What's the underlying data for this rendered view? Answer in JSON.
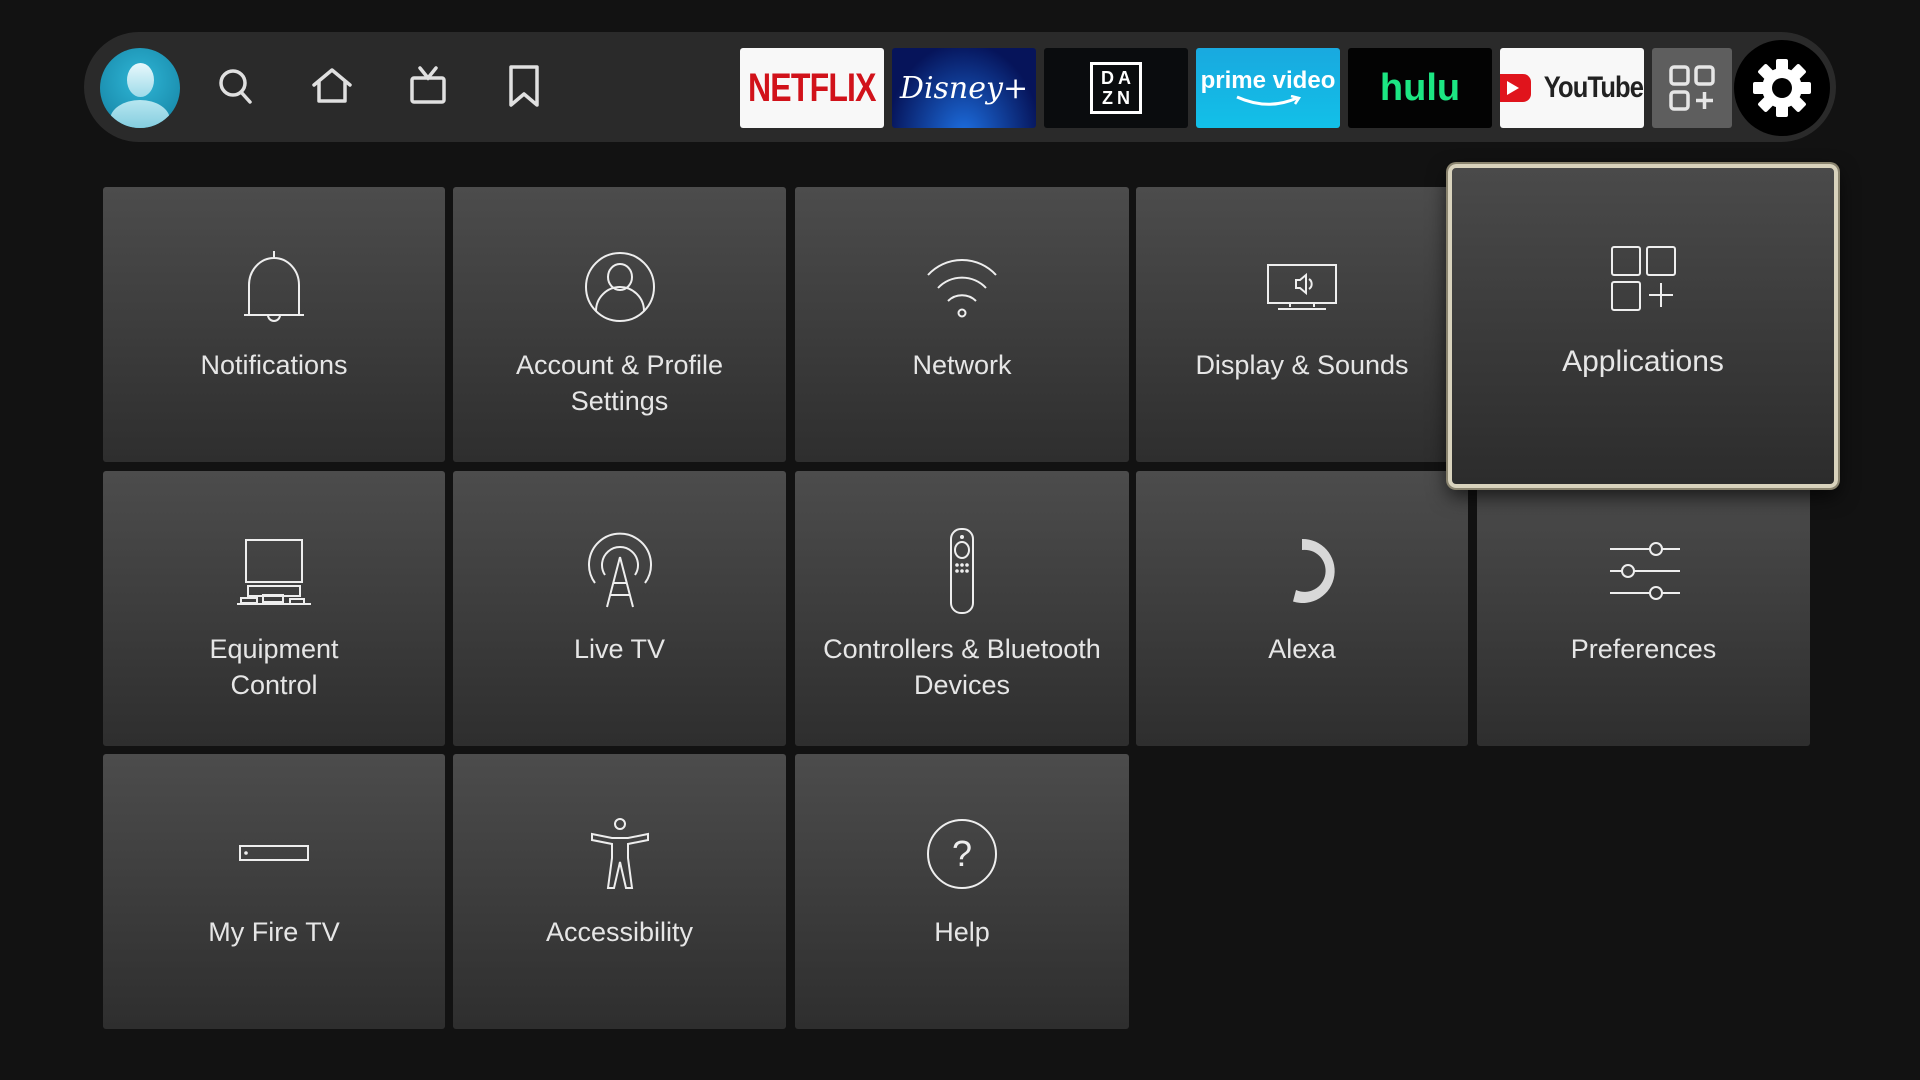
{
  "nav": {
    "icons": [
      {
        "name": "profile",
        "icon": "avatar-icon"
      },
      {
        "name": "search",
        "icon": "search-icon"
      },
      {
        "name": "home",
        "icon": "home-icon"
      },
      {
        "name": "live",
        "icon": "tv-icon"
      },
      {
        "name": "watchlist",
        "icon": "bookmark-icon"
      }
    ],
    "apps": [
      {
        "label": "NETFLIX"
      },
      {
        "label": "Disney+"
      },
      {
        "label_top": "DA",
        "label_bottom": "ZN"
      },
      {
        "label": "prime video"
      },
      {
        "label": "hulu"
      },
      {
        "label": "YouTube"
      }
    ],
    "all_apps_icon": "apps-grid-plus-icon",
    "settings_icon": "gear-icon"
  },
  "settings": {
    "tiles": [
      {
        "label": "Notifications",
        "icon": "bell-icon"
      },
      {
        "label": "Account & Profile Settings",
        "icon": "user-circle-icon"
      },
      {
        "label": "Network",
        "icon": "wifi-icon"
      },
      {
        "label": "Display & Sounds",
        "icon": "display-sound-icon"
      },
      {
        "label": "Applications",
        "icon": "apps-icon",
        "focused": true
      },
      {
        "label": "Equipment Control",
        "icon": "equipment-icon"
      },
      {
        "label": "Live TV",
        "icon": "antenna-icon"
      },
      {
        "label": "Controllers & Bluetooth Devices",
        "icon": "remote-icon"
      },
      {
        "label": "Alexa",
        "icon": "alexa-icon"
      },
      {
        "label": "Preferences",
        "icon": "sliders-icon"
      },
      {
        "label": "My Fire TV",
        "icon": "fire-tv-device-icon"
      },
      {
        "label": "Accessibility",
        "icon": "accessibility-icon"
      },
      {
        "label": "Help",
        "icon": "help-icon"
      }
    ]
  },
  "colors": {
    "focus_border": "#d9d3bd",
    "netflix_red": "#d1121a",
    "hulu_green": "#1ce783",
    "prime_blue": "#19a9df"
  }
}
